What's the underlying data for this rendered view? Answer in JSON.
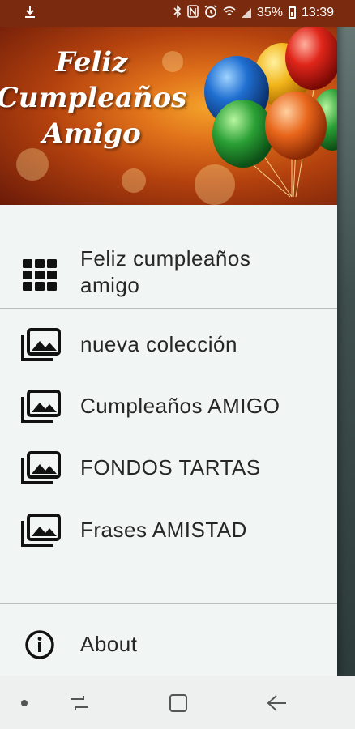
{
  "status_bar": {
    "battery_percent": "35%",
    "time": "13:39",
    "icons": [
      "download-icon",
      "bluetooth-icon",
      "nfc-icon",
      "alarm-icon",
      "wifi-icon",
      "signal-icon",
      "battery-icon"
    ]
  },
  "drawer": {
    "header": {
      "title_lines": [
        "Feliz",
        "Cumpleaños",
        "Amigo"
      ],
      "image": "birthday-balloons-image"
    },
    "items": [
      {
        "label": "Feliz cumpleaños amigo",
        "icon": "grid-icon"
      },
      {
        "label": "nueva colección",
        "icon": "photo-library-icon"
      },
      {
        "label": "Cumpleaños AMIGO",
        "icon": "photo-library-icon"
      },
      {
        "label": "FONDOS TARTAS",
        "icon": "photo-library-icon"
      },
      {
        "label": "Frases AMISTAD",
        "icon": "photo-library-icon"
      }
    ],
    "about": {
      "label": "About",
      "icon": "info-icon"
    }
  },
  "colors": {
    "drawer_bg": "#f1f5f4",
    "text": "#262626",
    "divider": "#b9bfbd",
    "icon": "#111111"
  },
  "nav_bar": {
    "buttons": [
      "dot-icon",
      "recent-apps-icon",
      "home-icon",
      "back-icon"
    ]
  }
}
